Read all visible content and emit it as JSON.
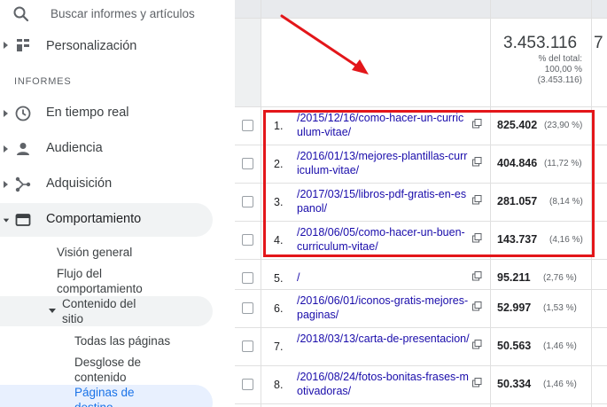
{
  "sidebar": {
    "search_placeholder": "Buscar informes y artículos",
    "personalizacion": "Personalización",
    "section_informes": "INFORMES",
    "items": [
      {
        "label": "En tiempo real"
      },
      {
        "label": "Audiencia"
      },
      {
        "label": "Adquisición"
      },
      {
        "label": "Comportamiento"
      }
    ],
    "vision_general": "Visión general",
    "flujo_line1": "Flujo del",
    "flujo_line2": "comportamiento",
    "contenido_line1": "Contenido del",
    "contenido_line2": "sitio",
    "todas_paginas": "Todas las páginas",
    "desglose_line1": "Desglose de",
    "desglose_line2": "contenido",
    "paginas_line1": "Páginas de",
    "paginas_line2": "destino"
  },
  "table": {
    "total_value": "3.453.116",
    "total_label_1": "% del total:",
    "total_label_2": "100,00 %",
    "total_label_3": "(3.453.116)",
    "next_col_partial": "7",
    "rows": [
      {
        "num": "1.",
        "path": "/2015/12/16/como-hacer-un-curriculum-vitae/",
        "value": "825.402",
        "pct": "(23,90 %)"
      },
      {
        "num": "2.",
        "path": "/2016/01/13/mejores-plantillas-curriculum-vitae/",
        "value": "404.846",
        "pct": "(11,72 %)"
      },
      {
        "num": "3.",
        "path": "/2017/03/15/libros-pdf-gratis-en-espanol/",
        "value": "281.057",
        "pct": "(8,14 %)"
      },
      {
        "num": "4.",
        "path": "/2018/06/05/como-hacer-un-buen-curriculum-vitae/",
        "value": "143.737",
        "pct": "(4,16 %)"
      },
      {
        "num": "5.",
        "path": "/",
        "value": "95.211",
        "pct": "(2,76 %)"
      },
      {
        "num": "6.",
        "path": "/2016/06/01/iconos-gratis-mejores-paginas/",
        "value": "52.997",
        "pct": "(1,53 %)"
      },
      {
        "num": "7.",
        "path": "/2018/03/13/carta-de-presentacion/",
        "value": "50.563",
        "pct": "(1,46 %)"
      },
      {
        "num": "8.",
        "path": "/2016/08/24/fotos-bonitas-frases-motivadoras/",
        "value": "50.334",
        "pct": "(1,46 %)"
      }
    ]
  },
  "colors": {
    "highlight": "#e3161a",
    "link": "#1a0dab",
    "active_blue": "#1a73e8"
  }
}
